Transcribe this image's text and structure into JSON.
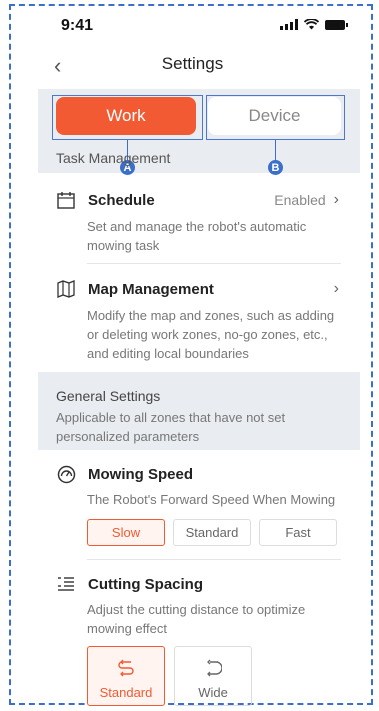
{
  "status_bar": {
    "time": "9:41"
  },
  "nav": {
    "back_icon": "chevron-left-icon",
    "title": "Settings"
  },
  "tabs": [
    {
      "label": "Work",
      "selected": true,
      "marker": "A"
    },
    {
      "label": "Device",
      "selected": false,
      "marker": "B"
    }
  ],
  "task_management": {
    "title": "Task Management",
    "items": [
      {
        "icon": "calendar-icon",
        "label": "Schedule",
        "value": "Enabled",
        "description": "Set and manage the robot's automatic mowing task"
      },
      {
        "icon": "map-icon",
        "label": "Map Management",
        "value": "",
        "description": "Modify the map and zones, such as adding or deleting work zones, no-go zones, etc., and editing local boundaries"
      }
    ]
  },
  "general_settings": {
    "title": "General Settings",
    "description": "Applicable to all zones that have not set personalized parameters"
  },
  "mowing_speed": {
    "icon": "speedometer-icon",
    "label": "Mowing Speed",
    "description": "The Robot's Forward Speed When Mowing",
    "options": [
      {
        "label": "Slow",
        "selected": true
      },
      {
        "label": "Standard",
        "selected": false
      },
      {
        "label": "Fast",
        "selected": false
      }
    ]
  },
  "cutting_spacing": {
    "icon": "spacing-icon",
    "label": "Cutting Spacing",
    "description": "Adjust the cutting distance to optimize mowing effect",
    "options": [
      {
        "label": "Standard",
        "selected": true
      },
      {
        "label": "Wide",
        "selected": false
      }
    ]
  },
  "colors": {
    "accent": "#f15a32",
    "annotation": "#3b6fc9",
    "section_bg": "#e9ecf0"
  }
}
